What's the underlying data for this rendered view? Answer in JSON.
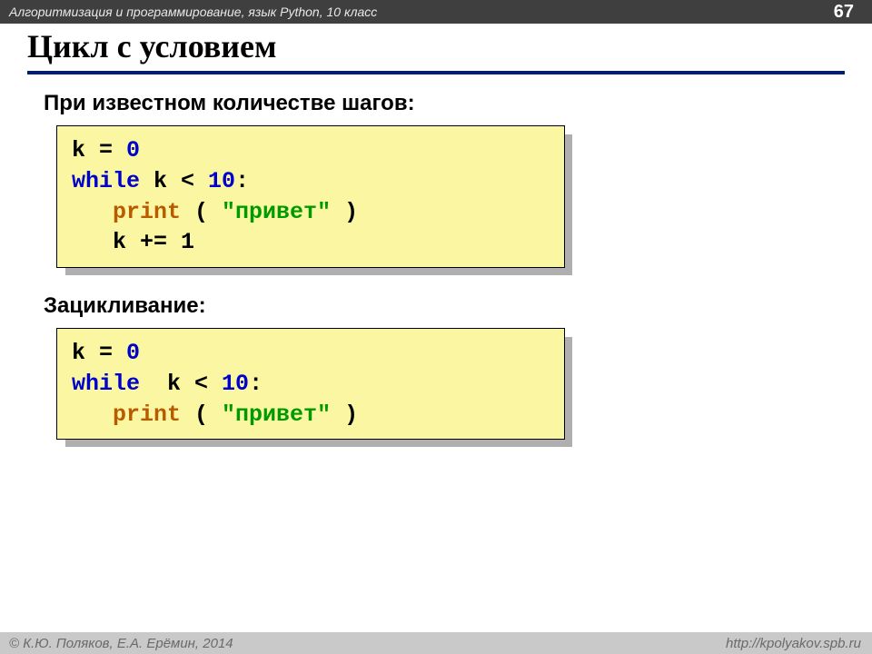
{
  "header": {
    "course": "Алгоритмизация и программирование, язык Python, 10 класс",
    "page_number": "67"
  },
  "footer": {
    "copyright": "© К.Ю. Поляков, Е.А. Ерёмин, 2014",
    "url": "http://kpolyakov.spb.ru"
  },
  "title": "Цикл с условием",
  "sections": {
    "known_steps": {
      "heading": "При известном количестве шагов:",
      "code": {
        "line1_lhs": "k",
        "line1_eq": " = ",
        "line1_num": "0",
        "line2_kw": "while",
        "line2_expr_a": " k",
        "line2_lt": " < ",
        "line2_num": "10",
        "line2_colon": ":",
        "line3_indent": "   ",
        "line3_fn": "print",
        "line3_paren_open": " ( ",
        "line3_str": "\"привет\"",
        "line3_paren_close": " )",
        "line4_indent": "   ",
        "line4_expr": "k += 1"
      }
    },
    "infinite": {
      "heading": "Зацикливание:",
      "code": {
        "line1_lhs": "k",
        "line1_eq": " = ",
        "line1_num": "0",
        "line2_kw": "while",
        "line2_expr_a": "  k",
        "line2_lt": " < ",
        "line2_num": "10",
        "line2_colon": ":",
        "line3_indent": "   ",
        "line3_fn": "print",
        "line3_paren_open": " ( ",
        "line3_str": "\"привет\"",
        "line3_paren_close": " )"
      }
    }
  }
}
